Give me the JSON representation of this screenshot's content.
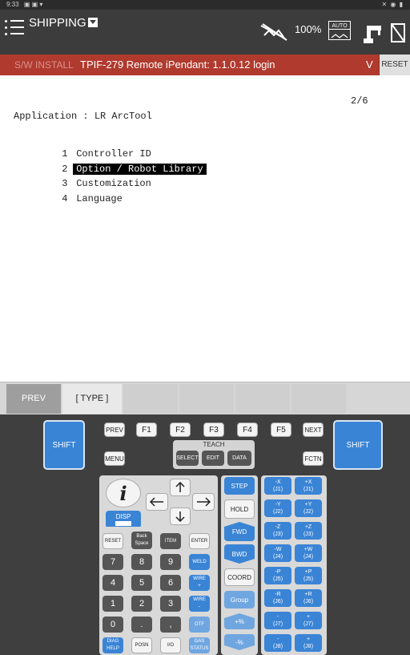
{
  "status_bar": {
    "time": "9:33",
    "indicators": "▣ ▣ ▾",
    "right_icons": "✕ ◉ ▮"
  },
  "header": {
    "title": "SHIPPING",
    "override": "100%",
    "auto_label": "AUTO",
    "icons": [
      "menu-icon",
      "dropdown-icon",
      "no-wire-icon",
      "auto-mode-icon",
      "robot-arm-icon",
      "frame-icon"
    ]
  },
  "infobar": {
    "sw_install": "S/W INSTALL",
    "program": "TPIF-279  Remote iPendant: 1.1.0.12 login",
    "chevron": "V",
    "reset": "RESET"
  },
  "screen": {
    "page": "2/6",
    "application": "Application : LR ArcTool",
    "items": [
      {
        "num": "1",
        "label": "Controller ID"
      },
      {
        "num": "2",
        "label": "Option / Robot Library"
      },
      {
        "num": "3",
        "label": "Customization"
      },
      {
        "num": "4",
        "label": "Language"
      }
    ],
    "selected_index": 1
  },
  "function_keys": {
    "prev": "PREV",
    "type": "[ TYPE ]"
  },
  "keypad": {
    "shift": "SHIFT",
    "prev": "PREV",
    "f1": "F1",
    "f2": "F2",
    "f3": "F3",
    "f4": "F4",
    "f5": "F5",
    "next": "NEXT",
    "menu": "MENU",
    "teach": "TEACH",
    "select": "SELECT",
    "edit": "EDIT",
    "data": "DATA",
    "fctn": "FCTN",
    "info": "i",
    "disp": "DISP",
    "step": "STEP",
    "hold": "HOLD",
    "fwd": "FWD",
    "bwd": "BWD",
    "coord": "COORD",
    "group": "Group",
    "speed_up": "+%",
    "speed_down": "-%",
    "reset": "RESET",
    "backspace": "Back\nSpace",
    "item": "ITEM",
    "enter": "ENTER",
    "weld": "WELD",
    "wire_plus": "WIRE\n+",
    "wire_minus": "WIRE\n-",
    "otf": "OTF",
    "gas_status": "GAS\nSTATUS",
    "diag_help": "DIAG\nHELP",
    "posn": "POSN",
    "io": "I/O",
    "digits": [
      "7",
      "8",
      "9",
      "4",
      "5",
      "6",
      "1",
      "2",
      "3",
      "0",
      ".",
      ","
    ],
    "jog_minus": [
      "-X\n(J1)",
      "-Y\n(J2)",
      "-Z\n(J3)",
      "-W\n(J4)",
      "-P\n(J5)",
      "-R\n(J6)",
      "-\n(J7)",
      "-\n(J8)"
    ],
    "jog_plus": [
      "+X\n(J1)",
      "+Y\n(J2)",
      "+Z\n(J3)",
      "+W\n(J4)",
      "+P\n(J5)",
      "+R\n(J6)",
      "+\n(J7)",
      "+\n(J8)"
    ]
  },
  "colors": {
    "header_bg": "#3c3c3c",
    "infobar_bg": "#b03a2e",
    "keypad_bg": "#3f3f3f",
    "key_blue": "#3a84d6",
    "selection_bg": "#000000"
  }
}
